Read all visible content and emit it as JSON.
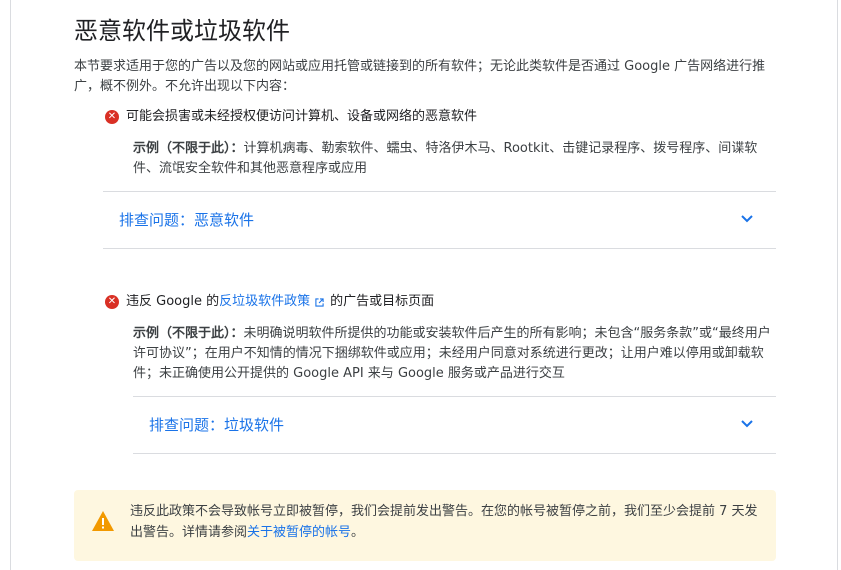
{
  "section": {
    "title": "恶意软件或垃圾软件",
    "intro": "本节要求适用于您的广告以及您的网站或应用托管或链接到的所有软件；无论此类软件是否通过 Google 广告网络进行推广，概不例外。不允许出现以下内容："
  },
  "items": [
    {
      "heading": "可能会损害或未经授权便访问计算机、设备或网络的恶意软件",
      "example_label": "示例（不限于此）：",
      "example_text": "计算机病毒、勒索软件、蠕虫、特洛伊木马、Rootkit、击键记录程序、拨号程序、间谍软件、流氓安全软件和其他恶意程序或应用",
      "troubleshoot_label": "排查问题：恶意软件"
    },
    {
      "heading_prefix": "违反 Google 的",
      "heading_link": "反垃圾软件政策",
      "heading_suffix": "的广告或目标页面",
      "example_label": "示例（不限于此）：",
      "example_text": "未明确说明软件所提供的功能或安装软件后产生的所有影响；未包含“服务条款”或“最终用户许可协议”；在用户不知情的情况下捆绑软件或应用；未经用户同意对系统进行更改；让用户难以停用或卸载软件；未正确使用公开提供的 Google API 来与 Google 服务或产品进行交互",
      "troubleshoot_label": "排查问题：垃圾软件"
    }
  ],
  "warning": {
    "text_before": "违反此政策不会导致帐号立即被暂停，我们会提前发出警告。在您的帐号被暂停之前，我们至少会提前 7 天发出警告。详情请参阅",
    "link": "关于被暂停的帐号",
    "text_after": "。"
  },
  "icons": {
    "error": "error-circle-icon",
    "external": "external-link-icon",
    "chevron": "chevron-down-icon",
    "warning": "warning-triangle-icon"
  },
  "colors": {
    "link": "#1a73e8",
    "error": "#d93025",
    "warning_bg": "#fef7e0",
    "warning_icon": "#f29900",
    "divider": "#dadce0"
  }
}
